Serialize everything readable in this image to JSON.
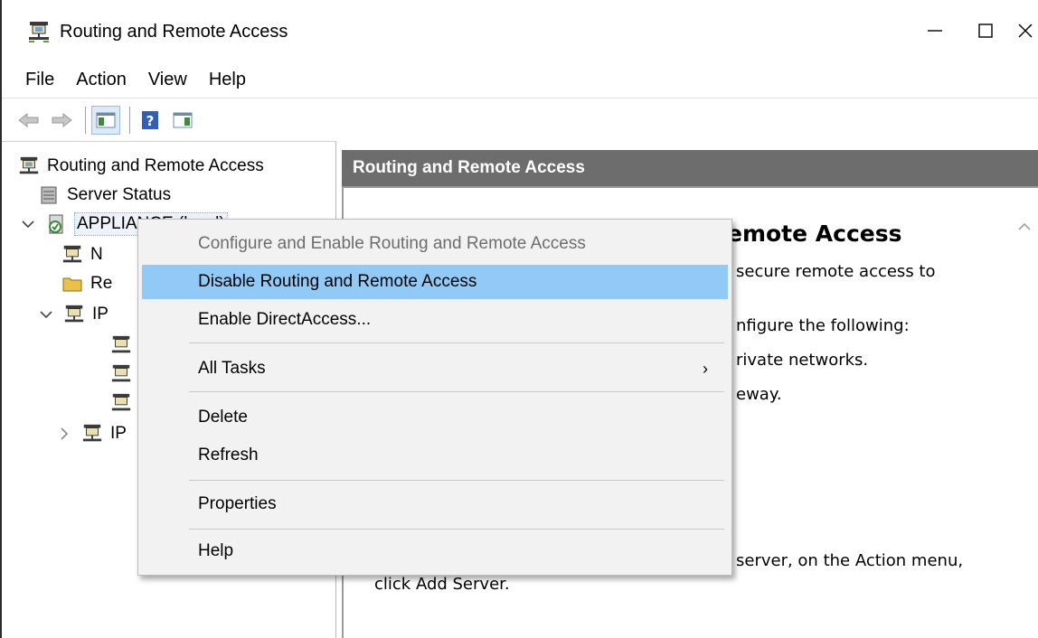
{
  "window": {
    "title": "Routing and Remote Access",
    "icon": "server-network-icon"
  },
  "menubar": {
    "items": [
      "File",
      "Action",
      "View",
      "Help"
    ]
  },
  "toolbar": {
    "icons": [
      "back-arrow-icon",
      "forward-arrow-icon",
      "show-hide-tree-icon",
      "help-icon",
      "action-pane-icon"
    ]
  },
  "tree": {
    "root": "Routing and Remote Access",
    "server_status": "Server Status",
    "appliance": "APPLIANCE (local)",
    "child_n": "N",
    "child_re": "Re",
    "child_ipv4": "IP",
    "child_ipv6": "IP"
  },
  "right_pane": {
    "header": "Routing and Remote Access",
    "heading_fragment": "emote Access",
    "line1": "secure remote access to",
    "line2": "nfigure the following:",
    "line3": "rivate networks.",
    "line4": "eway.",
    "line5": "server, on the Action menu,",
    "line6": "click Add Server."
  },
  "context_menu": {
    "configure": "Configure and Enable Routing and Remote Access",
    "disable": "Disable Routing and Remote Access",
    "directaccess": "Enable DirectAccess...",
    "all_tasks": "All Tasks",
    "submenu_arrow": "›",
    "delete": "Delete",
    "refresh": "Refresh",
    "properties": "Properties",
    "help": "Help"
  },
  "colors": {
    "menu_highlight": "#91c9f7",
    "pane_header": "#6d6d6d",
    "menu_bg": "#f2f2f2"
  }
}
